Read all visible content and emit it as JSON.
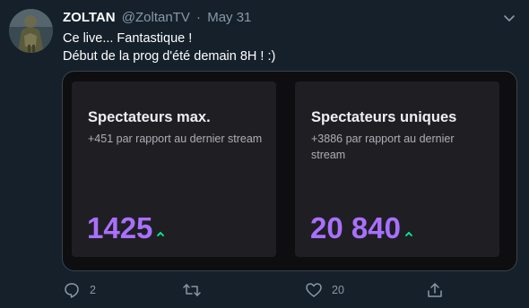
{
  "tweet": {
    "author_name": "ZOLTAN",
    "author_handle": "@ZoltanTV",
    "separator": "·",
    "date": "May 31",
    "text_lines": [
      "Ce live... Fantastique !",
      "Début de la prog d'été demain 8H ! :)"
    ]
  },
  "media": {
    "cards": [
      {
        "title": "Spectateurs max.",
        "subtitle": "+451 par rapport au dernier stream",
        "value": "1425",
        "trend_icon": "arrow-up-icon"
      },
      {
        "title": "Spectateurs uniques",
        "subtitle": "+3886 par rapport au dernier stream",
        "value": "20 840",
        "trend_icon": "arrow-up-icon"
      }
    ],
    "accent_color": "#a970ff",
    "trend_color": "#00f593"
  },
  "actions": {
    "reply_count": "2",
    "retweet_count": "",
    "like_count": "20"
  },
  "colors": {
    "background": "#15202b",
    "secondary_text": "#8899a6",
    "card_background": "#1f1f23"
  }
}
